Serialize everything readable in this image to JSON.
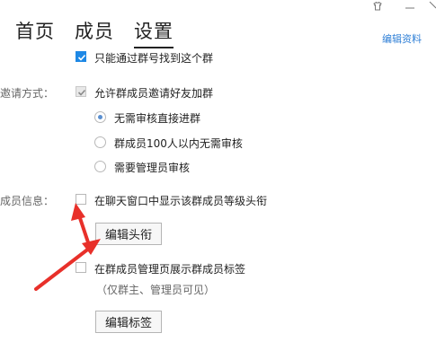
{
  "window": {
    "controls": {
      "skin_icon": "shirt-icon",
      "minimize_icon": "minimize-icon",
      "close_icon": "close-icon"
    }
  },
  "tabs": [
    {
      "label": "首页",
      "active": false
    },
    {
      "label": "成员",
      "active": false
    },
    {
      "label": "设置",
      "active": true
    }
  ],
  "header": {
    "edit_profile_link": "编辑资料"
  },
  "settings": {
    "search_option": {
      "label": "只能通过群号找到这个群",
      "checked": true
    },
    "invite": {
      "section_label": "邀请方式：",
      "allow_invite": {
        "label": "允许群成员邀请好友加群",
        "checked": true
      },
      "options": [
        {
          "label": "无需审核直接进群",
          "selected": true
        },
        {
          "label": "群成员100人以内无需审核",
          "selected": false
        },
        {
          "label": "需要管理员审核",
          "selected": false
        }
      ]
    },
    "member_info": {
      "section_label": "成员信息：",
      "show_level_title": {
        "label": "在聊天窗口中显示该群成员等级头衔",
        "checked": false
      },
      "edit_title_button": "编辑头衔",
      "show_member_tags": {
        "label": "在群成员管理页展示群成员标签",
        "checked": false
      },
      "tags_note": "（仅群主、管理员可见）",
      "edit_tags_button": "编辑标签"
    }
  },
  "colors": {
    "accent": "#1e88e5",
    "link": "#2f7fd6",
    "annotation_arrow": "#e8302a"
  }
}
